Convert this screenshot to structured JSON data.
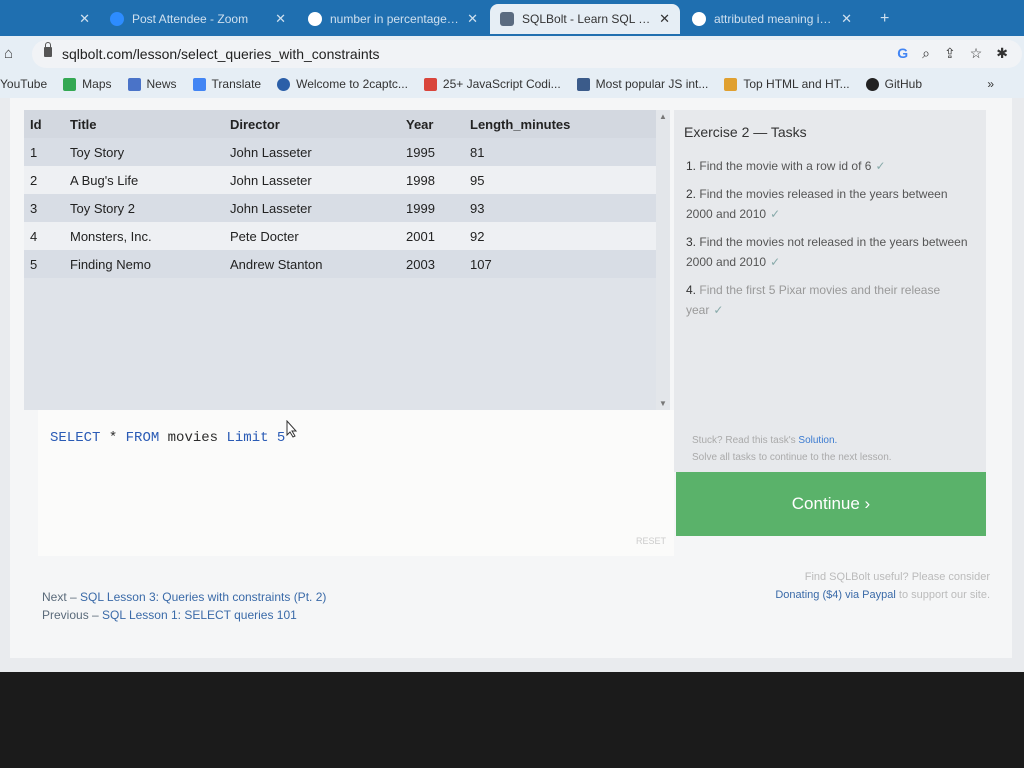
{
  "browser": {
    "tabs": [
      {
        "title": "",
        "favicon_color": "#1f6fb0"
      },
      {
        "title": "Post Attendee - Zoom",
        "favicon_color": "#2d8cff"
      },
      {
        "title": "number in percentage - C",
        "favicon_color": "#ffffff"
      },
      {
        "title": "SQLBolt - Learn SQL - SQ",
        "favicon_color": "#5a6b80"
      },
      {
        "title": "attributed meaning in tar",
        "favicon_color": "#ffffff"
      }
    ],
    "new_tab_label": "+",
    "url": "sqlbolt.com/lesson/select_queries_with_constraints",
    "bookmarks": [
      {
        "label": "YouTube",
        "color": ""
      },
      {
        "label": "Maps",
        "color": "#34a853"
      },
      {
        "label": "News",
        "color": "#4a73c8"
      },
      {
        "label": "Translate",
        "color": "#4285f4"
      },
      {
        "label": "Welcome to 2captc...",
        "color": "#2b5fa8"
      },
      {
        "label": "25+ JavaScript Codi...",
        "color": "#d9453b"
      },
      {
        "label": "Most popular JS int...",
        "color": "#3b5b8a"
      },
      {
        "label": "Top HTML and HT...",
        "color": "#e0a030"
      },
      {
        "label": "GitHub",
        "color": "#222222"
      }
    ],
    "bookmarks_more": "»"
  },
  "results": {
    "columns": [
      "Id",
      "Title",
      "Director",
      "Year",
      "Length_minutes"
    ],
    "rows": [
      [
        "1",
        "Toy Story",
        "John Lasseter",
        "1995",
        "81"
      ],
      [
        "2",
        "A Bug's Life",
        "John Lasseter",
        "1998",
        "95"
      ],
      [
        "3",
        "Toy Story 2",
        "John Lasseter",
        "1999",
        "93"
      ],
      [
        "4",
        "Monsters, Inc.",
        "Pete Docter",
        "2001",
        "92"
      ],
      [
        "5",
        "Finding Nemo",
        "Andrew Stanton",
        "2003",
        "107"
      ]
    ]
  },
  "editor": {
    "sql": {
      "select": "SELECT",
      "star": "*",
      "from": "FROM",
      "table": "movies",
      "limit": "Limit",
      "n": "5"
    },
    "reset_label": "RESET"
  },
  "tasks": {
    "title": "Exercise 2 — Tasks",
    "items": [
      "Find the movie with a row id of 6",
      "Find the movies released in the years between 2000 and 2010",
      "Find the movies not released in the years between 2000 and 2010",
      "Find the first 5 Pixar movies and their release year"
    ],
    "check": "✓",
    "stuck_text": "Stuck? Read this task's",
    "solution_link": "Solution.",
    "solve_all_text": "Solve all tasks to continue to the next lesson."
  },
  "continue_label": "Continue ›",
  "footer": {
    "next_prefix": "Next –",
    "next_link": "SQL Lesson 3: Queries with constraints (Pt. 2)",
    "prev_prefix": "Previous –",
    "prev_link": "SQL Lesson 1: SELECT queries 101",
    "donate_line1": "Find SQLBolt useful? Please consider",
    "donate_link": "Donating ($4) via Paypal",
    "donate_line2": "to support our site."
  }
}
